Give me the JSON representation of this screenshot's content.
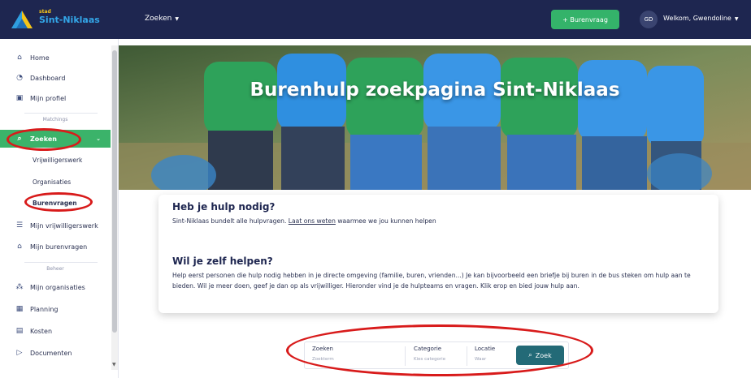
{
  "header": {
    "logo_small": "stad",
    "logo_name": "Sint-Niklaas",
    "nav_zoeken": "Zoeken",
    "burenvraag_button": "+ Burenvraag",
    "avatar_initials": "GD",
    "welcome": "Welkom, Gwendoline"
  },
  "sidebar": {
    "home": "Home",
    "dashboard": "Dashboard",
    "profiel": "Mijn profiel",
    "section_matchings": "Matchings",
    "zoeken": "Zoeken",
    "sub_vrijwilligerswerk": "Vrijwilligerswerk",
    "sub_organisaties": "Organisaties",
    "sub_burenvragen": "Burenvragen",
    "mijn_vrijwilligerswerk": "Mijn vrijwilligerswerk",
    "mijn_burenvragen": "Mijn burenvragen",
    "section_beheer": "Beheer",
    "mijn_organisaties": "Mijn organisaties",
    "planning": "Planning",
    "kosten": "Kosten",
    "documenten": "Documenten"
  },
  "hero": {
    "title": "Burenhulp zoekpagina Sint-Niklaas"
  },
  "card": {
    "heading1": "Heb je hulp nodig?",
    "text1_before": "Sint-Niklaas bundelt alle hulpvragen. ",
    "text1_link": "Laat ons weten",
    "text1_after": " waarmee we jou kunnen helpen",
    "heading2": "Wil je zelf helpen?",
    "text2": "Help eerst personen die hulp nodig hebben in je directe omgeving (familie, buren, vrienden...) Je kan bijvoorbeeld een briefje bij buren in de bus steken om hulp aan te bieden. Wil je meer doen, geef je dan op als vrijwilliger. Hieronder vind je de hulpteams en vragen. Klik erop en bied jouw hulp aan."
  },
  "search": {
    "zoeken_label": "Zoeken",
    "zoeken_placeholder": "Zoekterm",
    "categorie_label": "Categorie",
    "categorie_placeholder": "Kies categorie",
    "locatie_label": "Locatie",
    "locatie_placeholder": "Waar",
    "zoek_button": "Zoek"
  },
  "colors": {
    "topbar": "#1e2650",
    "accent_green": "#3bb36a",
    "zoek_button": "#236a77",
    "annotation_red": "#d81b1b"
  }
}
